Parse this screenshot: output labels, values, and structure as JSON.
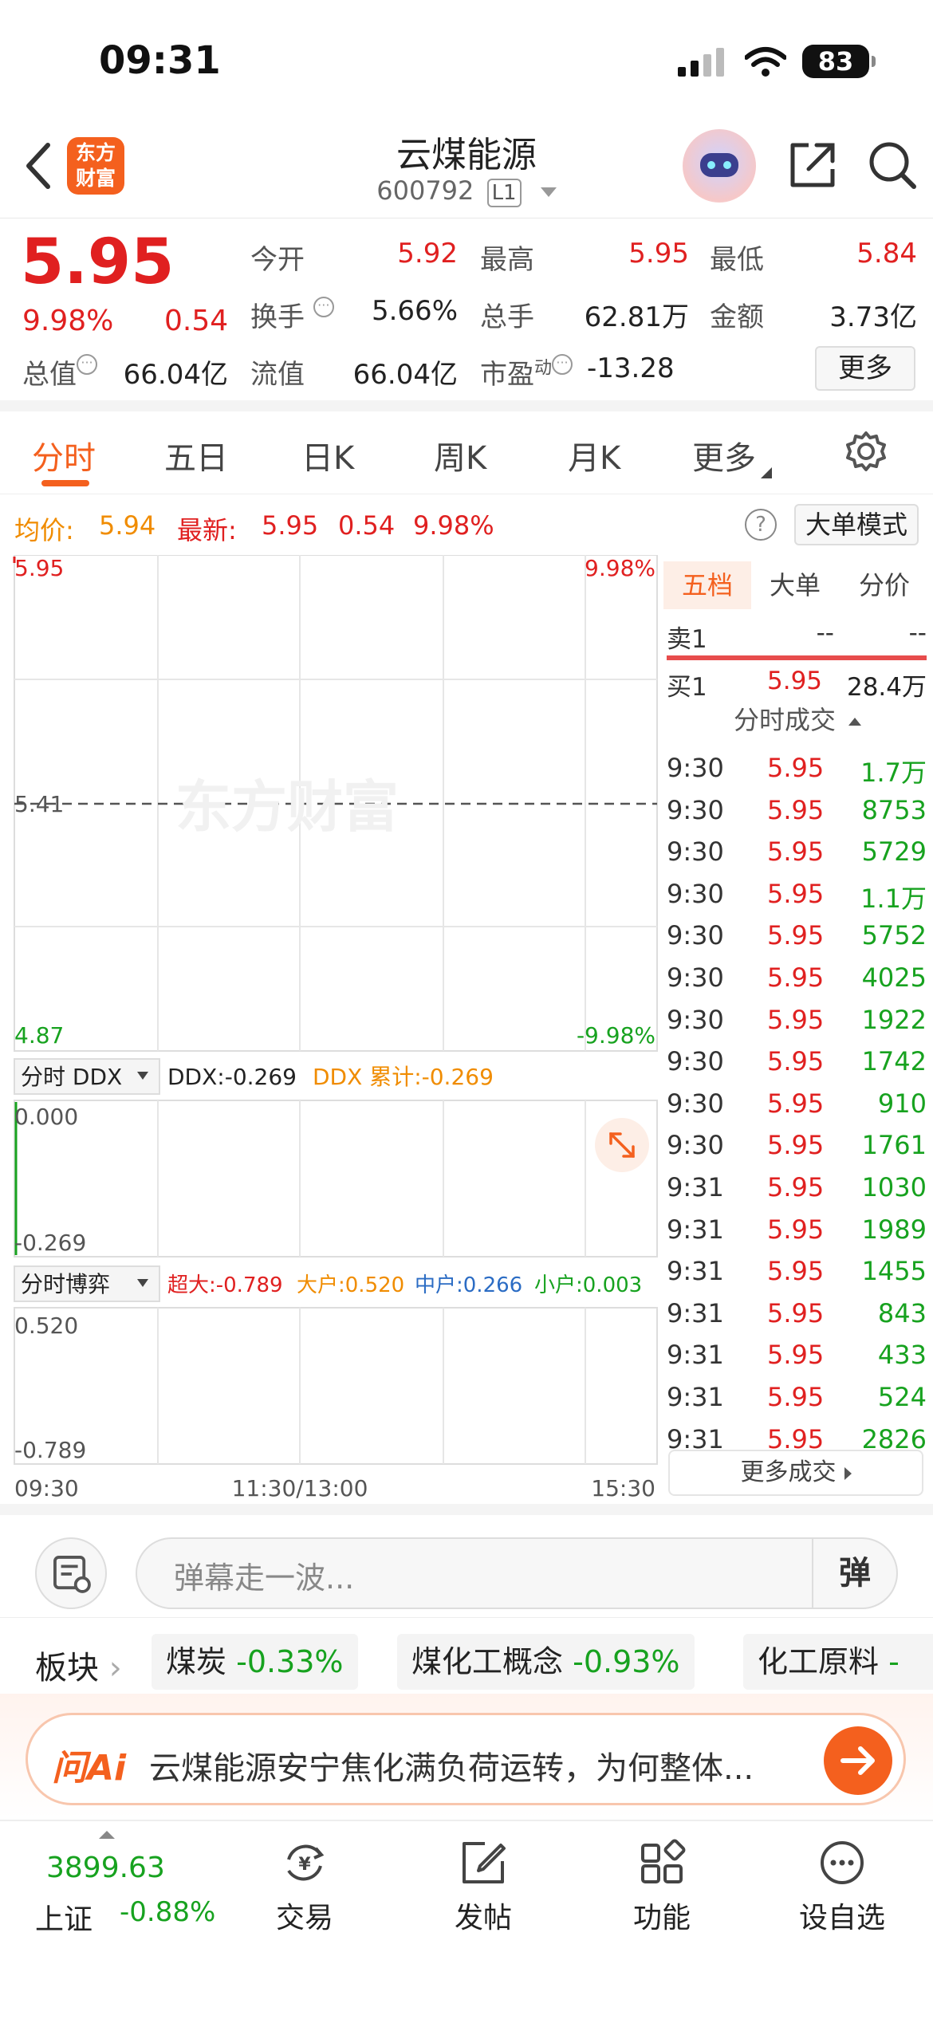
{
  "status": {
    "time": "09:31",
    "battery": "83"
  },
  "header": {
    "logo": "东方\n财富",
    "name": "云煤能源",
    "code": "600792",
    "level": "L1"
  },
  "quote": {
    "price": "5.95",
    "pct": "9.98%",
    "change": "0.54",
    "open_label": "今开",
    "open": "5.92",
    "high_label": "最高",
    "high": "5.95",
    "low_label": "最低",
    "low": "5.84",
    "turnover_label": "换手",
    "turnover": "5.66%",
    "volume_label": "总手",
    "volume": "62.81万",
    "amount_label": "金额",
    "amount": "3.73亿",
    "mktcap_label": "总值",
    "mktcap": "66.04亿",
    "float_label": "流值",
    "float": "66.04亿",
    "pe_label": "市盈",
    "pe_sup": "动",
    "pe": "-13.28",
    "more": "更多"
  },
  "tabs": [
    "分时",
    "五日",
    "日K",
    "周K",
    "月K",
    "更多"
  ],
  "avg": {
    "avg_label": "均价:",
    "avg": "5.94",
    "last_label": "最新:",
    "last": "5.95",
    "chg": "0.54",
    "pct": "9.98%",
    "bigorder_mode": "大单模式",
    "help": "?"
  },
  "chart": {
    "y_top": "5.95",
    "y_mid": "5.41",
    "y_bottom": "4.87",
    "pct_top": "9.98%",
    "pct_bottom": "-9.98%",
    "watermark": "东方财富",
    "ddx_selector": "分时 DDX",
    "ddx": "DDX:-0.269",
    "ddx_cum": "DDX 累计:-0.269",
    "ddx_top": "0.000",
    "ddx_bottom": "-0.269",
    "game_selector": "分时博弈",
    "game_super": "超大:-0.789",
    "game_big": "大户:0.520",
    "game_mid": "中户:0.266",
    "game_small": "小户:0.003",
    "game_top": "0.520",
    "game_bottom": "-0.789",
    "x_start": "09:30",
    "x_mid": "11:30/13:00",
    "x_end": "15:30"
  },
  "book": {
    "tabs": [
      "五档",
      "大单",
      "分价"
    ],
    "sell1": {
      "label": "卖1",
      "price": "--",
      "vol": "--"
    },
    "buy1": {
      "label": "买1",
      "price": "5.95",
      "vol": "28.4万"
    },
    "trades_title": "分时成交",
    "trades": [
      {
        "t": "9:30",
        "p": "5.95",
        "v": "1.7万"
      },
      {
        "t": "9:30",
        "p": "5.95",
        "v": "8753"
      },
      {
        "t": "9:30",
        "p": "5.95",
        "v": "5729"
      },
      {
        "t": "9:30",
        "p": "5.95",
        "v": "1.1万"
      },
      {
        "t": "9:30",
        "p": "5.95",
        "v": "5752"
      },
      {
        "t": "9:30",
        "p": "5.95",
        "v": "4025"
      },
      {
        "t": "9:30",
        "p": "5.95",
        "v": "1922"
      },
      {
        "t": "9:30",
        "p": "5.95",
        "v": "1742"
      },
      {
        "t": "9:30",
        "p": "5.95",
        "v": "910"
      },
      {
        "t": "9:30",
        "p": "5.95",
        "v": "1761"
      },
      {
        "t": "9:31",
        "p": "5.95",
        "v": "1030"
      },
      {
        "t": "9:31",
        "p": "5.95",
        "v": "1989"
      },
      {
        "t": "9:31",
        "p": "5.95",
        "v": "1455"
      },
      {
        "t": "9:31",
        "p": "5.95",
        "v": "843"
      },
      {
        "t": "9:31",
        "p": "5.95",
        "v": "433"
      },
      {
        "t": "9:31",
        "p": "5.95",
        "v": "524"
      },
      {
        "t": "9:31",
        "p": "5.95",
        "v": "2826"
      }
    ],
    "more_trades": "更多成交"
  },
  "danmaku": {
    "placeholder": "弹幕走一波...",
    "send": "弹"
  },
  "sectors": {
    "label": "板块",
    "items": [
      {
        "name": "煤炭",
        "pct": "-0.33%"
      },
      {
        "name": "煤化工概念",
        "pct": "-0.93%"
      },
      {
        "name": "化工原料",
        "pct": "-"
      }
    ]
  },
  "ai": {
    "logo": "问Ai",
    "text": "云煤能源安宁焦化满负荷运转，为何整体..."
  },
  "bottom_nav": {
    "index_value": "3899.63",
    "index_name": "上证",
    "index_pct": "-0.88%",
    "items": [
      "交易",
      "发帖",
      "功能",
      "设自选"
    ]
  },
  "colors": {
    "up": "#e02020",
    "down": "#17a21f",
    "accent": "#f4601e",
    "avg": "#f08c00"
  }
}
